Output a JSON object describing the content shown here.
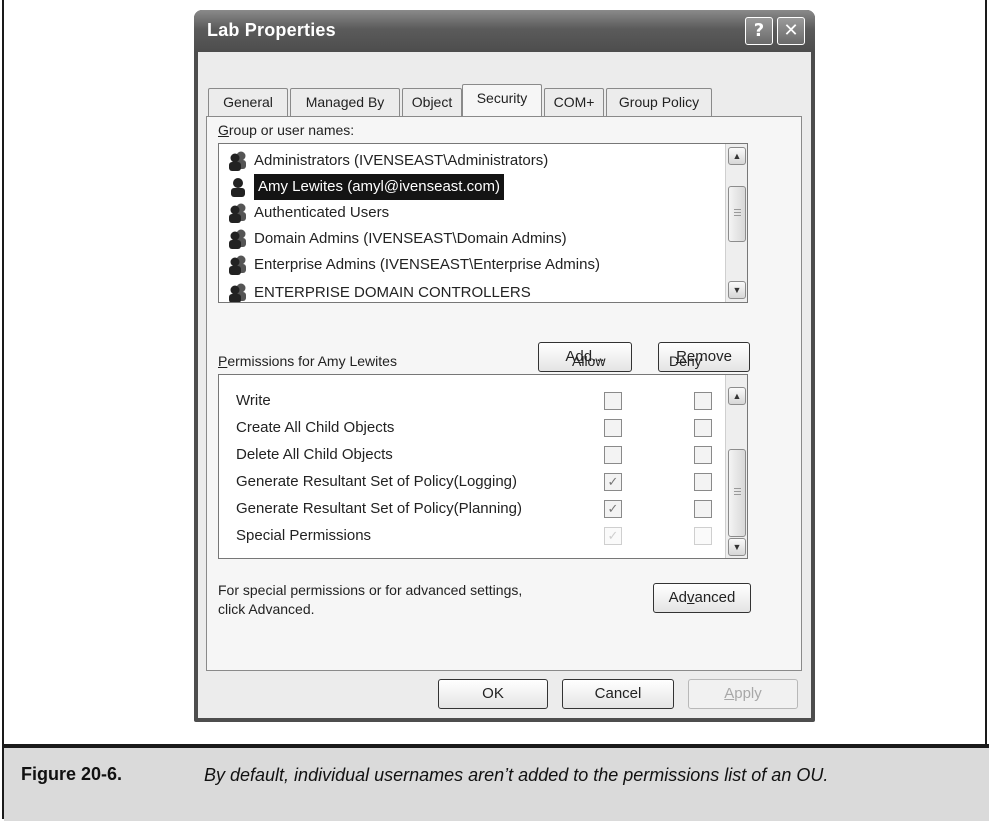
{
  "window": {
    "title": "Lab Properties",
    "help_glyph": "?",
    "close_glyph": "✕"
  },
  "tabs": [
    {
      "label": "General",
      "active": false
    },
    {
      "label": "Managed By",
      "active": false
    },
    {
      "label": "Object",
      "active": false
    },
    {
      "label": "Security",
      "active": true
    },
    {
      "label": "COM+",
      "active": false
    },
    {
      "label": "Group Policy",
      "active": false
    }
  ],
  "groups": {
    "label_accesskey": "G",
    "label_rest": "roup or user names:",
    "items": [
      {
        "name": "Administrators (IVENSEAST\\Administrators)",
        "icon": "group-icon",
        "selected": false
      },
      {
        "name": "Amy Lewites (amyl@ivenseast.com)",
        "icon": "user-icon",
        "selected": true
      },
      {
        "name": "Authenticated Users",
        "icon": "group-icon",
        "selected": false
      },
      {
        "name": "Domain Admins (IVENSEAST\\Domain Admins)",
        "icon": "group-icon",
        "selected": false
      },
      {
        "name": "Enterprise Admins (IVENSEAST\\Enterprise Admins)",
        "icon": "group-icon",
        "selected": false
      },
      {
        "name": "ENTERPRISE DOMAIN CONTROLLERS",
        "icon": "group-icon",
        "selected": false
      }
    ]
  },
  "buttons": {
    "add_pre": "A",
    "add_key": "d",
    "add_post": "d...",
    "remove_key": "R",
    "remove_post": "emove",
    "advanced_pre": "Ad",
    "advanced_key": "v",
    "advanced_post": "anced",
    "ok": "OK",
    "cancel": "Cancel",
    "apply_key": "A",
    "apply_post": "pply"
  },
  "permissions": {
    "label_key": "P",
    "label_rest": "ermissions for Amy Lewites",
    "allow_header": "Allow",
    "deny_header": "Deny",
    "rows": [
      {
        "name": "Write",
        "allow": false,
        "deny": false
      },
      {
        "name": "Create All Child Objects",
        "allow": false,
        "deny": false
      },
      {
        "name": "Delete All Child Objects",
        "allow": false,
        "deny": false
      },
      {
        "name": "Generate Resultant Set of Policy(Logging)",
        "allow": true,
        "deny": false
      },
      {
        "name": "Generate Resultant Set of Policy(Planning)",
        "allow": true,
        "deny": false
      },
      {
        "name": "Special Permissions",
        "allow": true,
        "deny": false
      }
    ]
  },
  "advanced_note": {
    "line1": "For special permissions or for advanced settings,",
    "line2": "click Advanced."
  },
  "figure": {
    "label": "Figure 20-6.",
    "caption": "By default, individual usernames aren’t added to the permissions list of an OU."
  },
  "scroll_glyphs": {
    "up": "▲",
    "down": "▼"
  },
  "check_glyph": "✓"
}
